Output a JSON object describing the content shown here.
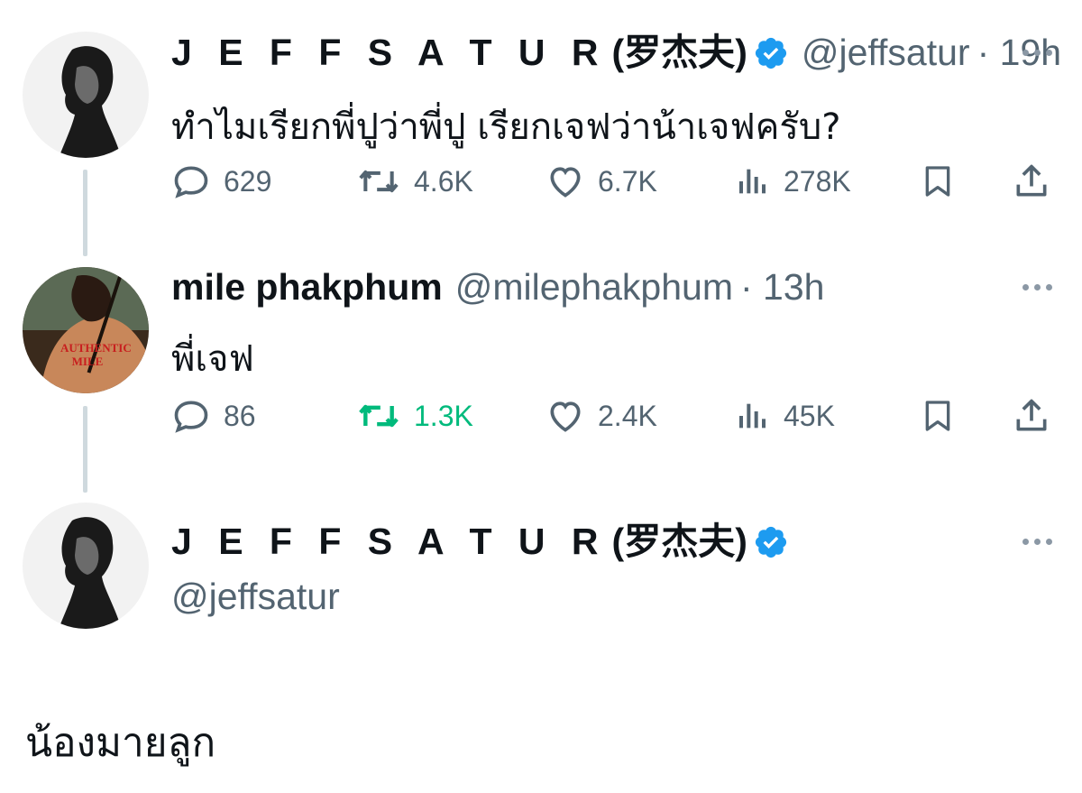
{
  "tweets": [
    {
      "display_name": "J E F F S A T U R",
      "display_name_suffix": "(罗杰夫)",
      "handle": "@jeffsatur",
      "time": "· 19h",
      "text": "ทำไมเรียกพี่ปูว่าพี่ปู เรียกเจฟว่าน้าเจฟครับ?",
      "replies": "629",
      "retweets": "4.6K",
      "likes": "6.7K",
      "views": "278K"
    },
    {
      "display_name": "mile phakphum",
      "handle": "@milephakphum",
      "time": "· 13h",
      "text": "พี่เจฟ",
      "replies": "86",
      "retweets": "1.3K",
      "likes": "2.4K",
      "views": "45K",
      "avatar_poster_title": "AUTHENTIC MILE"
    }
  ],
  "main_tweet": {
    "display_name": "J E F F S A T U R",
    "display_name_suffix": "(罗杰夫)",
    "handle": "@jeffsatur",
    "text": "น้องมายลูก"
  },
  "colors": {
    "verified": "#1d9bf0",
    "retweet_active": "#00ba7c",
    "muted": "#536471"
  }
}
